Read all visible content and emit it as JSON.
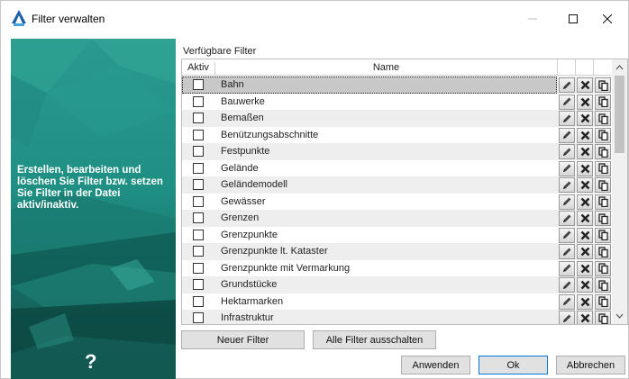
{
  "window": {
    "title": "Filter verwalten"
  },
  "banner": {
    "text": "Erstellen, bearbeiten und löschen Sie Filter bzw. setzen Sie Filter in der Datei aktiv/inaktiv.",
    "help_mark": "?"
  },
  "panel": {
    "section_label": "Verfügbare Filter",
    "columns": {
      "aktiv": "Aktiv",
      "name": "Name"
    }
  },
  "filters": [
    {
      "name": "Bahn",
      "active": false,
      "selected": true
    },
    {
      "name": "Bauwerke",
      "active": false
    },
    {
      "name": "Bemaßen",
      "active": false
    },
    {
      "name": "Benützungsabschnitte",
      "active": false
    },
    {
      "name": "Festpunkte",
      "active": false
    },
    {
      "name": "Gelände",
      "active": false
    },
    {
      "name": "Geländemodell",
      "active": false
    },
    {
      "name": "Gewässer",
      "active": false
    },
    {
      "name": "Grenzen",
      "active": false
    },
    {
      "name": "Grenzpunkte",
      "active": false
    },
    {
      "name": "Grenzpunkte lt. Kataster",
      "active": false
    },
    {
      "name": "Grenzpunkte mit Vermarkung",
      "active": false
    },
    {
      "name": "Grundstücke",
      "active": false
    },
    {
      "name": "Hektarmarken",
      "active": false
    },
    {
      "name": "Infrastruktur",
      "active": false
    }
  ],
  "row_actions": {
    "edit_icon": "pencil-icon",
    "delete_icon": "x-icon",
    "copy_icon": "copy-icon"
  },
  "buttons": {
    "new_filter": "Neuer Filter",
    "all_off": "Alle Filter ausschalten",
    "apply": "Anwenden",
    "ok": "Ok",
    "cancel": "Abbrechen"
  },
  "colors": {
    "accent": "#0078d7",
    "banner": "#1d8b80",
    "selected_row": "#c8c8c8"
  }
}
